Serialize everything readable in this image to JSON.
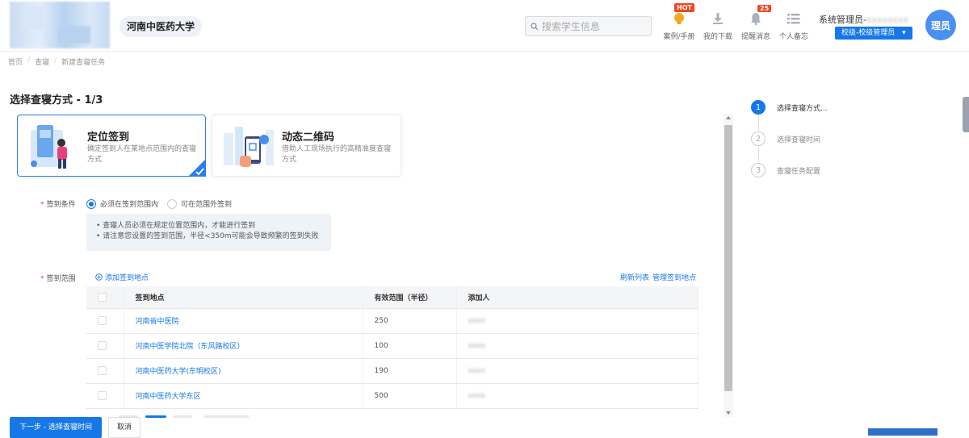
{
  "header": {
    "school_name": "河南中医药大学",
    "search_placeholder": "搜索学生信息",
    "tools": [
      {
        "label": "案例/手册",
        "icon": "lightbulb-icon",
        "badge": "HOT"
      },
      {
        "label": "我的下载",
        "icon": "download-icon"
      },
      {
        "label": "提醒消息",
        "icon": "bell-icon",
        "badge": "25"
      },
      {
        "label": "个人备忘",
        "icon": "list-icon"
      }
    ],
    "user_prefix": "系统管理员-",
    "user_blurred": "xxxxxxxx",
    "role": "校级-校级管理员",
    "avatar_text": "理员"
  },
  "breadcrumb": [
    "首页",
    "查寝",
    "新建查寝任务"
  ],
  "page_title": "选择查寝方式 - 1/3",
  "methods": [
    {
      "title": "定位签到",
      "desc": "确定签到人在某地点范围内的查寝方式",
      "selected": true
    },
    {
      "title": "动态二维码",
      "desc": "借助人工现场执行的高精准度查寝方式",
      "selected": false
    }
  ],
  "form": {
    "condition_label": "签到条件",
    "radio_must": "必须在签到范围内",
    "radio_outside": "可在范围外签到",
    "tips": [
      "• 查寝人员必须在规定位置范围内，才能进行签到",
      "• 请注意您设置的签到范围，半径<350m可能会导致频繁的签到失败"
    ],
    "range_label": "签到范围",
    "add_location": "添加签到地点",
    "refresh_list": "刷新列表",
    "manage_locations": "管理签到地点"
  },
  "table": {
    "headers": [
      "签到地点",
      "有效范围（半径）",
      "添加人"
    ],
    "rows": [
      {
        "location": "河南省中医院",
        "radius": "250",
        "adder": "xxxx"
      },
      {
        "location": "河南中医学院北院（东风路校区）",
        "radius": "100",
        "adder": "xxxx"
      },
      {
        "location": "河南中医药大学(东明校区)",
        "radius": "190",
        "adder": "xxxx"
      },
      {
        "location": "河南中医药大学东区",
        "radius": "500",
        "adder": "xxxx"
      }
    ]
  },
  "steps": [
    {
      "num": "1",
      "label": "选择查寝方式..."
    },
    {
      "num": "2",
      "label": "选择查寝时间"
    },
    {
      "num": "3",
      "label": "查寝任务配置"
    }
  ],
  "footer": {
    "next_label": "下一步 - 选择查寝时间",
    "cancel_label": "取消"
  },
  "colors": {
    "accent": "#1677e8",
    "badge": "#f5451e",
    "required": "#f5451e"
  }
}
